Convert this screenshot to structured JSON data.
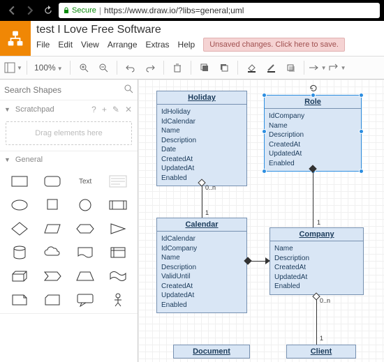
{
  "browser": {
    "secure_label": "Secure",
    "url": "https://www.draw.io/?libs=general;uml"
  },
  "header": {
    "title": "test I Love Free Software",
    "menus": [
      "File",
      "Edit",
      "View",
      "Arrange",
      "Extras",
      "Help"
    ],
    "unsaved": "Unsaved changes. Click here to save."
  },
  "toolbar": {
    "zoom": "100%"
  },
  "sidebar": {
    "search_placeholder": "Search Shapes",
    "scratchpad": "Scratchpad",
    "dropzone": "Drag elements here",
    "general": "General",
    "text_cell": "Text"
  },
  "uml": {
    "holiday": {
      "title": "Holiday",
      "body": "IdHoliday\nIdCalendar\nName\nDescription\nDate\nCreatedAt\nUpdatedAt\nEnabled"
    },
    "role": {
      "title": "Role",
      "body": "IdCompany\nName\nDescription\nCreatedAt\nUpdatedAt\nEnabled"
    },
    "calendar": {
      "title": "Calendar",
      "body": "IdCalendar\nIdCompany\nName\nDescription\nValidUntil\nCreatedAt\nUpdatedAt\nEnabled"
    },
    "company": {
      "title": "Company",
      "body": "Name\nDescription\nCreatedAt\nUpdatedAt\nEnabled"
    },
    "document": {
      "title": "Document"
    },
    "client": {
      "title": "Client"
    }
  },
  "labels": {
    "zero_n": "0..n",
    "one": "1"
  }
}
